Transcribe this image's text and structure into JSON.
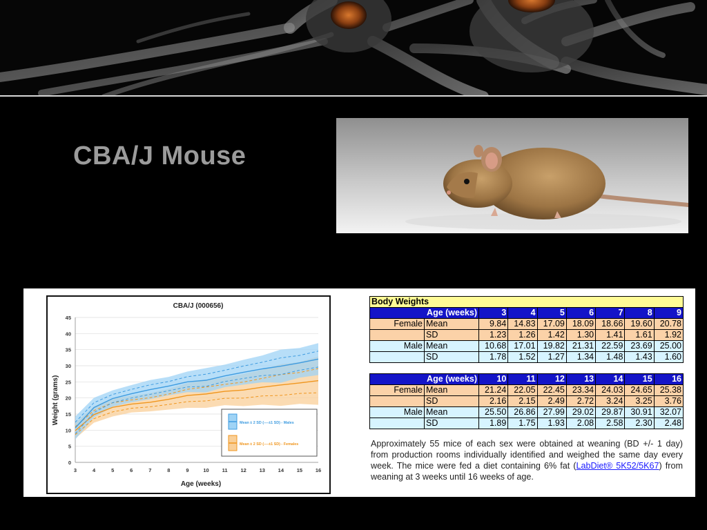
{
  "slide": {
    "title": "CBA/J Mouse"
  },
  "chart": {
    "title": "CBA/J (000656)",
    "ylabel": "Weight (grams)",
    "xlabel": "Age (weeks)",
    "legend_males": "Mean ± 2 SD (----±1 SD) - Males",
    "legend_females": "Mean ± 2 SD (----±1 SD) - Females",
    "colors": {
      "male": "#3d9be0",
      "male_band": "#9fd3f5",
      "female": "#f0961e",
      "female_band": "#f9cf98"
    }
  },
  "chart_data": {
    "type": "line",
    "title": "CBA/J (000656)",
    "xlabel": "Age (weeks)",
    "ylabel": "Weight (grams)",
    "x": [
      3,
      4,
      5,
      6,
      7,
      8,
      9,
      10,
      11,
      12,
      13,
      14,
      15,
      16
    ],
    "xlim": [
      3,
      16
    ],
    "ylim": [
      0,
      45
    ],
    "yticks": [
      0,
      5,
      10,
      15,
      20,
      25,
      30,
      35,
      40,
      45
    ],
    "grid": true,
    "legend": "bottom-right",
    "series": [
      {
        "name": "Mean ± 2 SD (----±1 SD) - Males",
        "mean": [
          10.68,
          17.01,
          19.82,
          21.31,
          22.59,
          23.69,
          25.0,
          25.5,
          26.86,
          27.99,
          29.02,
          29.87,
          30.91,
          32.07
        ],
        "sd": [
          1.78,
          1.52,
          1.27,
          1.34,
          1.48,
          1.43,
          1.6,
          1.89,
          1.75,
          1.93,
          2.08,
          2.58,
          2.3,
          2.48
        ]
      },
      {
        "name": "Mean ± 2 SD (----±1 SD) - Females",
        "mean": [
          9.84,
          14.83,
          17.09,
          18.09,
          18.66,
          19.6,
          20.78,
          21.24,
          22.05,
          22.45,
          23.34,
          24.03,
          24.65,
          25.38
        ],
        "sd": [
          1.23,
          1.26,
          1.42,
          1.3,
          1.41,
          1.61,
          1.92,
          2.16,
          2.15,
          2.49,
          2.72,
          3.24,
          3.25,
          3.76
        ]
      }
    ]
  },
  "table": {
    "title": "Body Weights",
    "age_label": "Age (weeks)",
    "female_label": "Female",
    "male_label": "Male",
    "mean_label": "Mean",
    "sd_label": "SD",
    "block1": {
      "ages": [
        "3",
        "4",
        "5",
        "6",
        "7",
        "8",
        "9"
      ],
      "female_mean": [
        "9.84",
        "14.83",
        "17.09",
        "18.09",
        "18.66",
        "19.60",
        "20.78"
      ],
      "female_sd": [
        "1.23",
        "1.26",
        "1.42",
        "1.30",
        "1.41",
        "1.61",
        "1.92"
      ],
      "male_mean": [
        "10.68",
        "17.01",
        "19.82",
        "21.31",
        "22.59",
        "23.69",
        "25.00"
      ],
      "male_sd": [
        "1.78",
        "1.52",
        "1.27",
        "1.34",
        "1.48",
        "1.43",
        "1.60"
      ]
    },
    "block2": {
      "ages": [
        "10",
        "11",
        "12",
        "13",
        "14",
        "15",
        "16"
      ],
      "female_mean": [
        "21.24",
        "22.05",
        "22.45",
        "23.34",
        "24.03",
        "24.65",
        "25.38"
      ],
      "female_sd": [
        "2.16",
        "2.15",
        "2.49",
        "2.72",
        "3.24",
        "3.25",
        "3.76"
      ],
      "male_mean": [
        "25.50",
        "26.86",
        "27.99",
        "29.02",
        "29.87",
        "30.91",
        "32.07"
      ],
      "male_sd": [
        "1.89",
        "1.75",
        "1.93",
        "2.08",
        "2.58",
        "2.30",
        "2.48"
      ]
    }
  },
  "description": {
    "text_before": "Approximately 55 mice of each sex were obtained at weaning (BD +/- 1 day) from production rooms individually identified and weighed the same day every week. The mice were fed a diet containing 6% fat (",
    "link": "LabDiet® 5K52/5K67",
    "text_after": ") from weaning at 3 weeks until 16 weeks of age."
  }
}
